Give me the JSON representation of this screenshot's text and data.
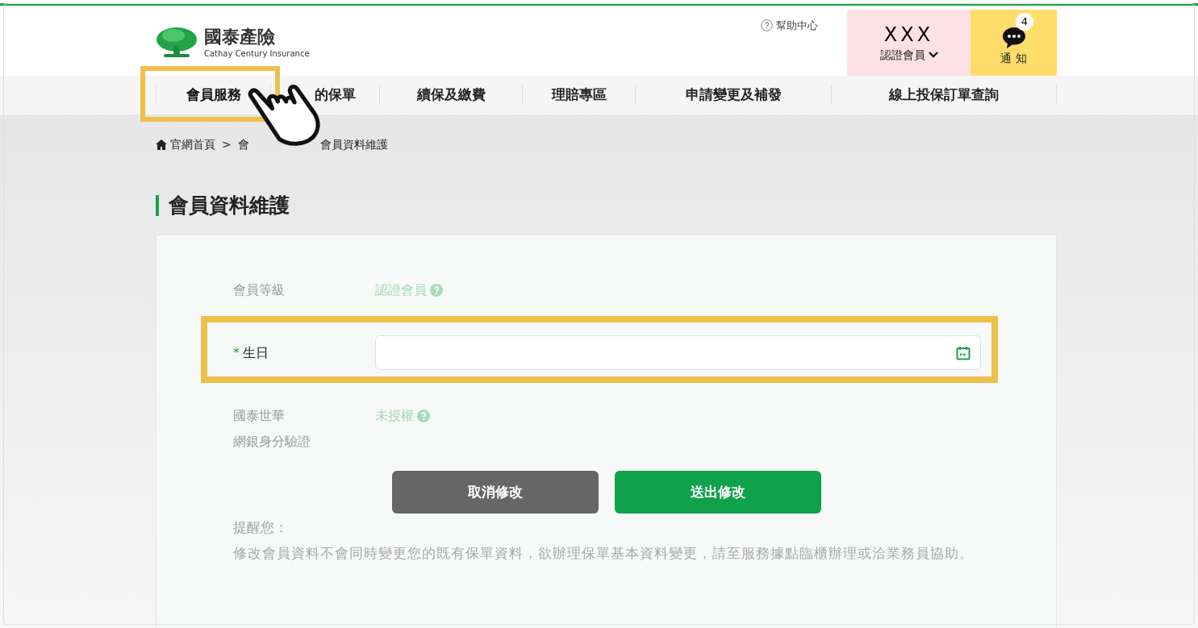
{
  "header": {
    "logo": {
      "name": "國泰產險",
      "subtitle": "Cathay Century Insurance"
    },
    "help": "幫助中心",
    "member": {
      "name": "XXX",
      "level": "認證會員"
    },
    "notify": {
      "label": "通 知",
      "count": "4"
    }
  },
  "nav": [
    {
      "label": "會員服務",
      "selected": true
    },
    {
      "label": "的保單",
      "selected": false
    },
    {
      "label": "續保及繳費",
      "selected": false
    },
    {
      "label": "理賠專區",
      "selected": false
    },
    {
      "label": "申請變更及補發",
      "selected": false
    },
    {
      "label": "線上投保訂單查詢",
      "selected": false
    }
  ],
  "breadcrumb": [
    "官網首頁",
    ">",
    "會",
    "會員資料維護"
  ],
  "title": "會員資料維護",
  "form": [
    {
      "kind": "info",
      "label_lines": [
        "會員等級"
      ],
      "value": "認證會員"
    },
    {
      "kind": "date",
      "label_lines": [
        "生日"
      ],
      "marker": "*"
    },
    {
      "kind": "info",
      "label_lines": [
        "國泰世華",
        "網銀身分驗證"
      ],
      "value": "未授權"
    }
  ],
  "buttons": [
    {
      "kind": "cancel",
      "label": "取消修改"
    },
    {
      "kind": "submit",
      "label": "送出修改"
    }
  ],
  "reminder": {
    "title": "提醒您：",
    "body": "修改會員資料不會同時變更您的既有保單資料，欲辦理保單基本資料變更，請至服務據點臨櫃辦理或洽業務員協助。"
  }
}
